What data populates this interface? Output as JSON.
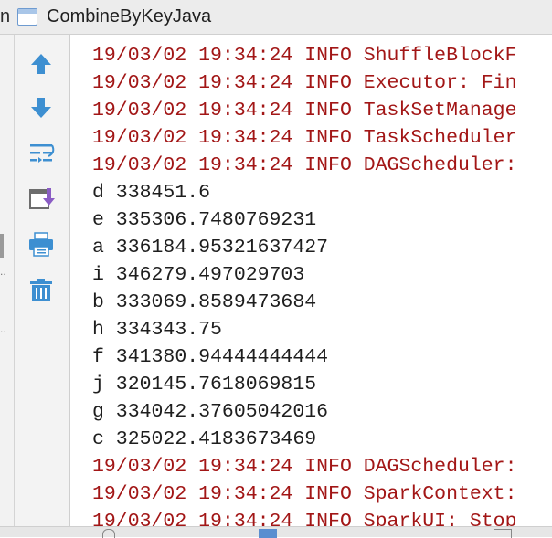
{
  "tabbar": {
    "fragment": "n",
    "title": "CombineByKeyJava",
    "icon": "run-window-icon"
  },
  "toolbar": {
    "buttons": [
      {
        "icon": "arrow-up-icon",
        "color": "#3d8fd1"
      },
      {
        "icon": "arrow-down-icon",
        "color": "#3d8fd1"
      },
      {
        "icon": "soft-wrap-icon",
        "color": "#3d8fd1"
      },
      {
        "icon": "scroll-to-end-icon",
        "color": "#8a5cc4"
      },
      {
        "icon": "print-icon",
        "color": "#3d8fd1"
      },
      {
        "icon": "trash-icon",
        "color": "#3d8fd1"
      }
    ]
  },
  "colors": {
    "log_error": "#a21616",
    "log_output": "#1e1e1e",
    "toolbar_bg": "#f3f3f3"
  },
  "console": {
    "lines": [
      {
        "text": "19/03/02 19:34:24 INFO ShuffleBlockF",
        "stream": "err"
      },
      {
        "text": "19/03/02 19:34:24 INFO Executor: Fin",
        "stream": "err"
      },
      {
        "text": "19/03/02 19:34:24 INFO TaskSetManage",
        "stream": "err"
      },
      {
        "text": "19/03/02 19:34:24 INFO TaskScheduler",
        "stream": "err"
      },
      {
        "text": "19/03/02 19:34:24 INFO DAGScheduler:",
        "stream": "err"
      },
      {
        "text": "d 338451.6",
        "stream": "out"
      },
      {
        "text": "e 335306.7480769231",
        "stream": "out"
      },
      {
        "text": "a 336184.95321637427",
        "stream": "out"
      },
      {
        "text": "i 346279.497029703",
        "stream": "out"
      },
      {
        "text": "b 333069.8589473684",
        "stream": "out"
      },
      {
        "text": "h 334343.75",
        "stream": "out"
      },
      {
        "text": "f 341380.94444444444",
        "stream": "out"
      },
      {
        "text": "j 320145.7618069815",
        "stream": "out"
      },
      {
        "text": "g 334042.37605042016",
        "stream": "out"
      },
      {
        "text": "c 325022.4183673469",
        "stream": "out"
      },
      {
        "text": "19/03/02 19:34:24 INFO DAGScheduler:",
        "stream": "err"
      },
      {
        "text": "19/03/02 19:34:24 INFO SparkContext:",
        "stream": "err"
      },
      {
        "text": "19/03/02 19:34:24 INFO SparkUI: Stop",
        "stream": "err"
      }
    ]
  }
}
